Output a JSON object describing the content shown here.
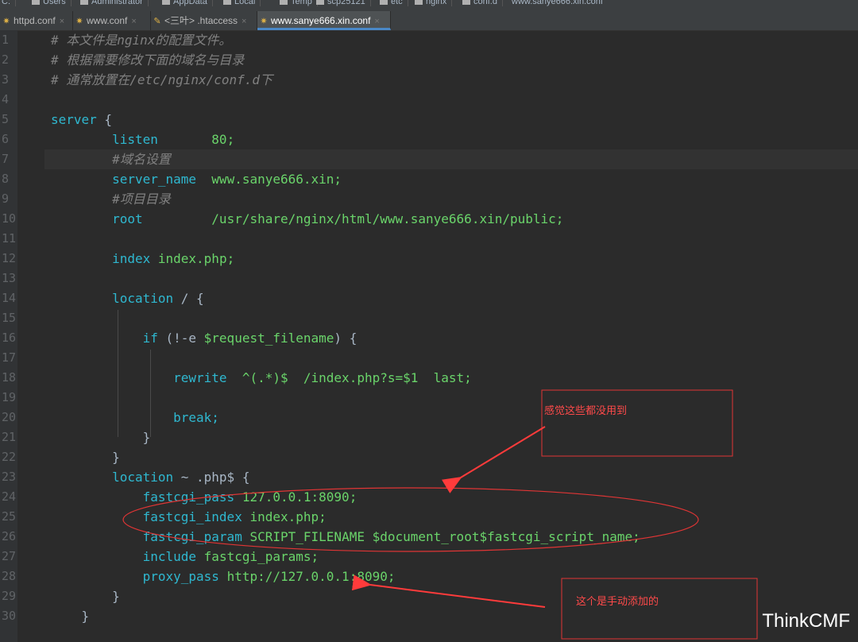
{
  "breadcrumb": [
    "C:",
    "Users",
    "Administrator",
    "AppData",
    "Local",
    "Temp",
    "scp25121",
    "etc",
    "nginx",
    "conf.d",
    "www.sanye666.xin.conf"
  ],
  "tabs": [
    {
      "label": "httpd.conf",
      "icon": "gear-icon",
      "active": false
    },
    {
      "label": "www.conf",
      "icon": "gear-icon",
      "active": false
    },
    {
      "label": "<三叶> .htaccess",
      "icon": "file-icon",
      "active": false
    },
    {
      "label": "www.sanye666.xin.conf",
      "icon": "gear-icon",
      "active": true
    }
  ],
  "tab_close": "×",
  "line_numbers": [
    "1",
    "2",
    "3",
    "4",
    "5",
    "6",
    "7",
    "8",
    "9",
    "10",
    "11",
    "12",
    "13",
    "14",
    "15",
    "16",
    "17",
    "18",
    "19",
    "20",
    "21",
    "22",
    "23",
    "24",
    "25",
    "26",
    "27",
    "28",
    "29",
    "30"
  ],
  "code_lines": [
    [
      [
        "cm",
        "# 本文件是nginx的配置文件。"
      ]
    ],
    [
      [
        "cm",
        "# 根据需要修改下面的域名与目录"
      ]
    ],
    [
      [
        "cm",
        "# 通常放置在/etc/nginx/conf.d下"
      ]
    ],
    [],
    [
      [
        "kw",
        "server"
      ],
      [
        "txt",
        " {"
      ]
    ],
    [
      [
        "txt",
        "        "
      ],
      [
        "kw",
        "listen"
      ],
      [
        "txt",
        "       "
      ],
      [
        "val",
        "80;"
      ]
    ],
    [
      [
        "txt",
        "        "
      ],
      [
        "cm",
        "#域名设置"
      ]
    ],
    [
      [
        "txt",
        "        "
      ],
      [
        "kw",
        "server_name"
      ],
      [
        "txt",
        "  "
      ],
      [
        "val",
        "www.sanye666.xin;"
      ]
    ],
    [
      [
        "txt",
        "        "
      ],
      [
        "cm",
        "#项目目录"
      ]
    ],
    [
      [
        "txt",
        "        "
      ],
      [
        "kw",
        "root"
      ],
      [
        "txt",
        "         "
      ],
      [
        "val",
        "/usr/share/nginx/html/www.sanye666.xin/public;"
      ]
    ],
    [],
    [
      [
        "txt",
        "        "
      ],
      [
        "kw",
        "index"
      ],
      [
        "txt",
        " "
      ],
      [
        "val",
        "index.php;"
      ]
    ],
    [],
    [
      [
        "txt",
        "        "
      ],
      [
        "kw",
        "location"
      ],
      [
        "txt",
        " / {"
      ]
    ],
    [],
    [
      [
        "txt",
        "            "
      ],
      [
        "kw",
        "if"
      ],
      [
        "txt",
        " (!-e "
      ],
      [
        "val",
        "$request_filename"
      ],
      [
        "txt",
        ") {"
      ]
    ],
    [],
    [
      [
        "txt",
        "                "
      ],
      [
        "kw",
        "rewrite"
      ],
      [
        "txt",
        "  "
      ],
      [
        "val",
        "^(.*)$  /index.php?s=$1  last;"
      ]
    ],
    [],
    [
      [
        "txt",
        "                "
      ],
      [
        "kw",
        "break;"
      ]
    ],
    [
      [
        "txt",
        "            }"
      ]
    ],
    [
      [
        "txt",
        "        }"
      ]
    ],
    [
      [
        "txt",
        "        "
      ],
      [
        "kw",
        "location"
      ],
      [
        "txt",
        " ~ .php$ {"
      ]
    ],
    [
      [
        "txt",
        "            "
      ],
      [
        "kw",
        "fastcgi_pass"
      ],
      [
        "txt",
        " "
      ],
      [
        "val",
        "127.0.0.1:8090;"
      ]
    ],
    [
      [
        "txt",
        "            "
      ],
      [
        "kw",
        "fastcgi_index"
      ],
      [
        "txt",
        " "
      ],
      [
        "val",
        "index.php;"
      ]
    ],
    [
      [
        "txt",
        "            "
      ],
      [
        "kw",
        "fastcgi_param"
      ],
      [
        "txt",
        " "
      ],
      [
        "val",
        "SCRIPT_FILENAME $document_root$fastcgi_script_name;"
      ]
    ],
    [
      [
        "txt",
        "            "
      ],
      [
        "kw",
        "include"
      ],
      [
        "txt",
        " "
      ],
      [
        "val",
        "fastcgi_params;"
      ]
    ],
    [
      [
        "txt",
        "            "
      ],
      [
        "kw",
        "proxy_pass"
      ],
      [
        "txt",
        " "
      ],
      [
        "val",
        "http://127.0.0.1:8090;"
      ]
    ],
    [
      [
        "txt",
        "        }"
      ]
    ],
    [
      [
        "txt",
        "    }"
      ]
    ]
  ],
  "annotations": {
    "note1": "感觉这些都没用到",
    "note2": "这个是手动添加的",
    "color": "#ff3b3b"
  },
  "watermark": "ThinkCMF"
}
